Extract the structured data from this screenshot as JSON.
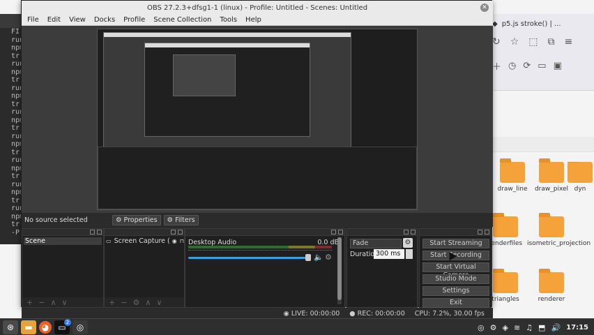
{
  "obs": {
    "title": "OBS 27.2.3+dfsg1-1 (linux) - Profile: Untitled - Scenes: Untitled",
    "menu": [
      "File",
      "Edit",
      "View",
      "Docks",
      "Profile",
      "Scene Collection",
      "Tools",
      "Help"
    ],
    "source_status": "No source selected",
    "properties_label": "Properties",
    "filters_label": "Filters",
    "scenes": {
      "items": [
        "Scene"
      ]
    },
    "sources": {
      "items": [
        "Screen Capture (X"
      ]
    },
    "mixer": {
      "channel": "Desktop Audio",
      "level": "0.0 dB"
    },
    "transitions": {
      "selected": "Fade",
      "duration_label": "Duration",
      "duration_value": "300 ms"
    },
    "controls": [
      "Start Streaming",
      "Start Recording",
      "Start Virtual Camera",
      "Studio Mode",
      "Settings",
      "Exit"
    ],
    "status": {
      "live": "LIVE: 00:00:00",
      "rec": "REC: 00:00:00",
      "cpu": "CPU: 7.2%, 30.00 fps"
    }
  },
  "browser": {
    "tab_title": "p5.js stroke() | ..."
  },
  "file_manager": {
    "folders": [
      "draw_line",
      "draw_pixel",
      "dyn",
      "renderfiles",
      "isometric_projection",
      "triangles",
      "renderer"
    ]
  },
  "terminal": {
    "lines": [
      "FI",
      "run",
      "npm",
      "tr",
      "run",
      "npm",
      "tr",
      "run",
      "npm",
      "tr",
      "run",
      "npm",
      "tr",
      "run",
      "npm",
      "tr",
      "run",
      "npm",
      "tr",
      "run",
      "npm",
      "tr",
      "run",
      "npm",
      "tr",
      "-P"
    ]
  },
  "taskbar": {
    "clock": "17:15",
    "badge": "2"
  },
  "colors": {
    "accent": "#3fa0d8",
    "folder": "#f6a23a"
  }
}
